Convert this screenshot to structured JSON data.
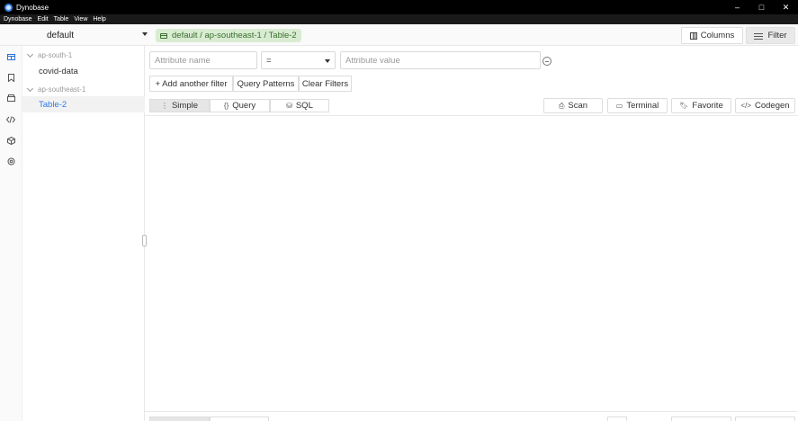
{
  "window": {
    "title": "Dynobase",
    "minimize": "–",
    "maximize": "□",
    "close": "✕"
  },
  "menu": [
    "Dynobase",
    "Edit",
    "Table",
    "View",
    "Help"
  ],
  "header": {
    "profile": "default",
    "breadcrumb": "default / ap-southeast-1 / Table-2",
    "columns_label": "Columns",
    "filter_label": "Filter"
  },
  "rail": {
    "icons": [
      "tables-icon",
      "bookmark-icon",
      "backups-icon",
      "code-icon",
      "box-icon",
      "settings-icon"
    ]
  },
  "tree": {
    "regions": [
      {
        "name": "ap-south-1",
        "tables": [
          "covid-data"
        ]
      },
      {
        "name": "ap-southeast-1",
        "tables": [
          "Table-2"
        ]
      }
    ],
    "selected": "Table-2"
  },
  "filter": {
    "attribute_placeholder": "Attribute name",
    "operator": "=",
    "value_placeholder": "Attribute value",
    "add_filter": "+ Add another filter",
    "query_patterns": "Query Patterns",
    "clear_filters": "Clear Filters"
  },
  "modes": {
    "simple": "Simple",
    "query": "Query",
    "sql": "SQL",
    "active": "simple"
  },
  "actions": {
    "scan": "Scan",
    "terminal": "Terminal",
    "favorite": "Favorite",
    "codegen": "Codegen"
  },
  "colors": {
    "accent": "#2f7be5",
    "tag_bg": "#d9ecd2",
    "tag_text": "#3a6e2e",
    "titlebar": "#000000"
  }
}
